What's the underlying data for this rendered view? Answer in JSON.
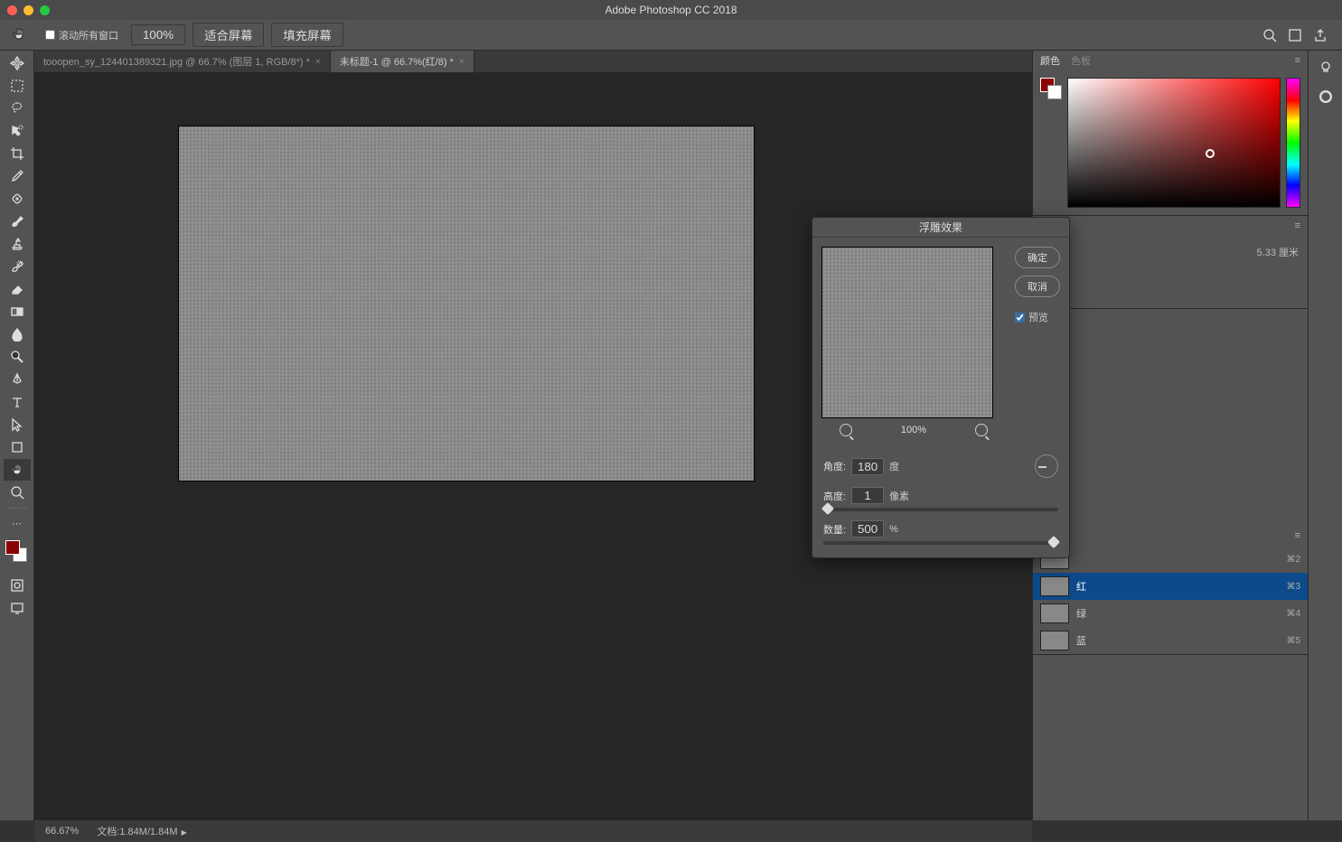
{
  "app_title": "Adobe Photoshop CC 2018",
  "options": {
    "scroll_all_label": "滚动所有窗口",
    "zoom_level": "100%",
    "fit_screen": "适合屏幕",
    "fill_screen": "填充屏幕"
  },
  "tabs": {
    "tab1": "tooopen_sy_124401389321.jpg @ 66.7% (图层 1, RGB/8*) *",
    "tab2": "未标题-1 @ 66.7%(红/8) *"
  },
  "color_panel": {
    "tab1": "颜色",
    "tab2": "色板"
  },
  "properties_panel": {
    "dimensions_text": "5.33 厘米"
  },
  "channels": [
    {
      "name": "",
      "key": "⌘2"
    },
    {
      "name": "红",
      "key": "⌘3"
    },
    {
      "name": "绿",
      "key": "⌘4"
    },
    {
      "name": "蓝",
      "key": "⌘5"
    }
  ],
  "dialog": {
    "title": "浮雕效果",
    "ok": "确定",
    "cancel": "取消",
    "preview_label": "预览",
    "zoom_pct": "100%",
    "angle_label": "角度:",
    "angle_value": "180",
    "angle_unit": "度",
    "height_label": "高度:",
    "height_value": "1",
    "height_unit": "像素",
    "amount_label": "数量:",
    "amount_value": "500",
    "amount_unit": "%"
  },
  "status": {
    "zoom": "66.67%",
    "doc_info": "文档:1.84M/1.84M"
  }
}
